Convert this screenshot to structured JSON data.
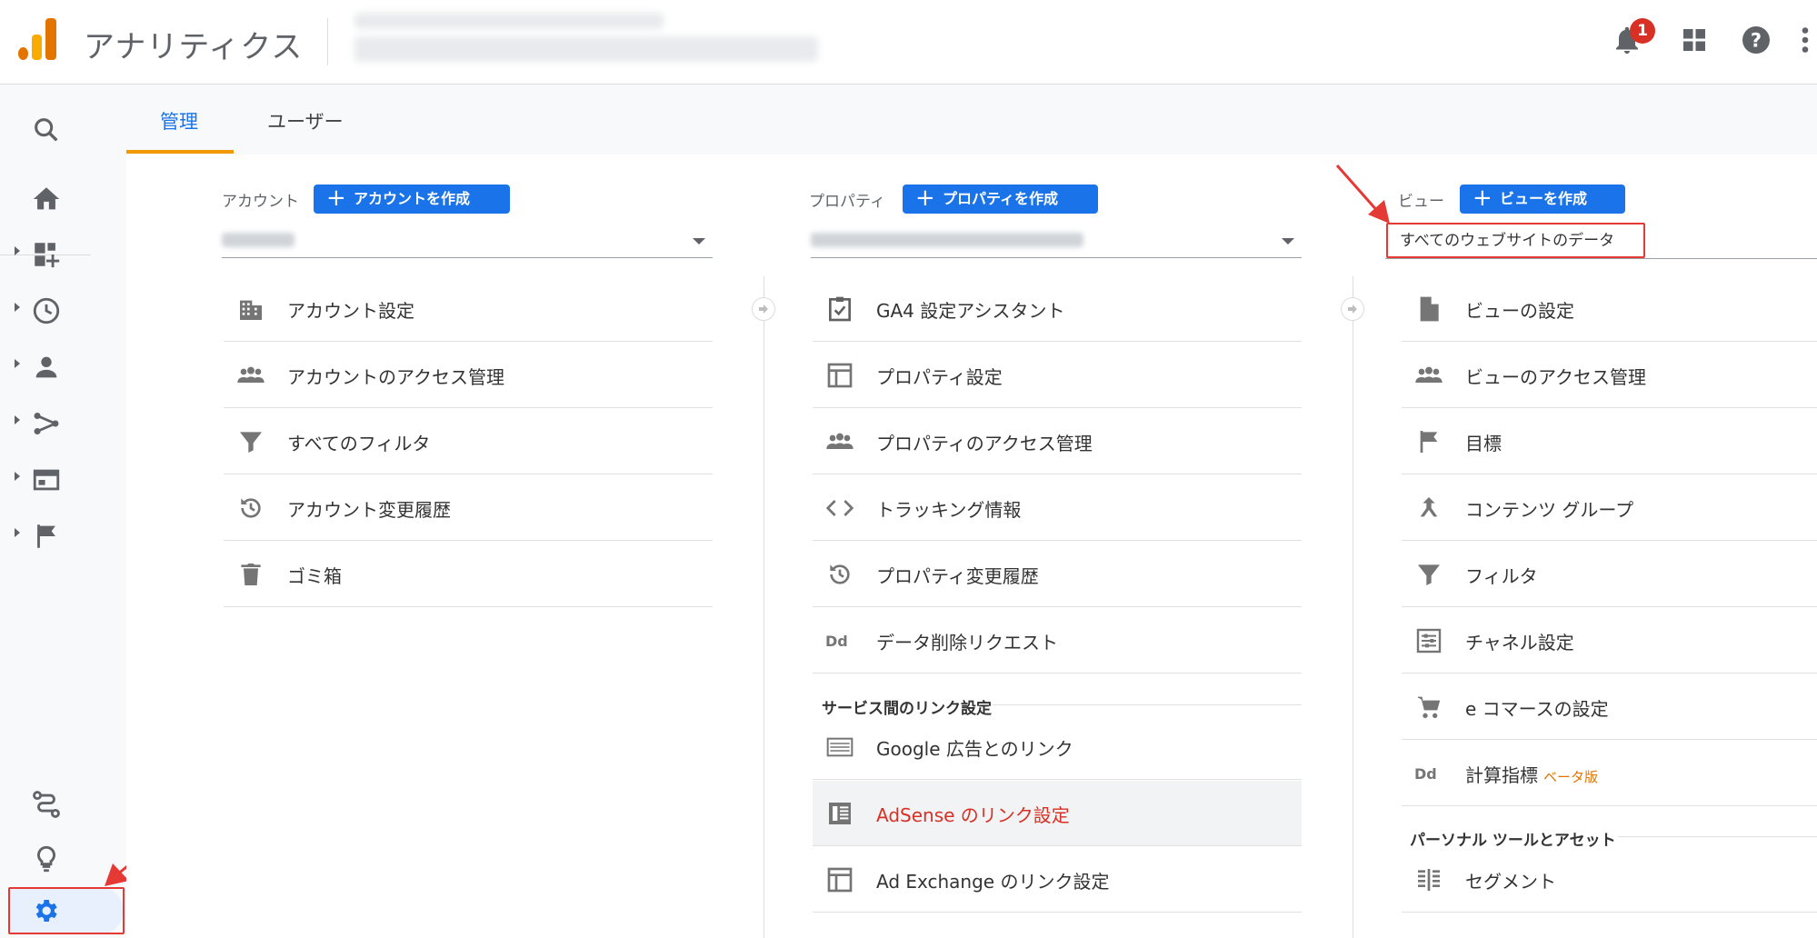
{
  "header": {
    "app_title": "アナリティクス",
    "notification_count": "1"
  },
  "tabs": [
    {
      "label": "管理",
      "active": true
    },
    {
      "label": "ユーザー",
      "active": false
    }
  ],
  "account_col": {
    "label": "アカウント",
    "create_label": "アカウントを作成",
    "items": [
      {
        "label": "アカウント設定",
        "icon": "building-icon"
      },
      {
        "label": "アカウントのアクセス管理",
        "icon": "people-icon"
      },
      {
        "label": "すべてのフィルタ",
        "icon": "filter-icon"
      },
      {
        "label": "アカウント変更履歴",
        "icon": "history-icon"
      },
      {
        "label": "ゴミ箱",
        "icon": "trash-icon"
      }
    ]
  },
  "property_col": {
    "label": "プロパティ",
    "create_label": "プロパティを作成",
    "items": [
      {
        "label": "GA4 設定アシスタント",
        "icon": "clipboard-check-icon"
      },
      {
        "label": "プロパティ設定",
        "icon": "layout-icon"
      },
      {
        "label": "プロパティのアクセス管理",
        "icon": "people-icon"
      },
      {
        "label": "トラッキング情報",
        "icon": "code-icon"
      },
      {
        "label": "プロパティ変更履歴",
        "icon": "history-icon"
      },
      {
        "label": "データ削除リクエスト",
        "icon": "dd-icon"
      }
    ],
    "section_title": "サービス間のリンク設定",
    "link_items": [
      {
        "label": "Google 広告とのリンク",
        "icon": "ads-icon"
      },
      {
        "label": "AdSense のリンク設定",
        "icon": "adsense-icon"
      },
      {
        "label": "Ad Exchange のリンク設定",
        "icon": "layout-icon"
      }
    ]
  },
  "view_col": {
    "label": "ビュー",
    "create_label": "ビューを作成",
    "selected_view": "すべてのウェブサイトのデータ",
    "items": [
      {
        "label": "ビューの設定",
        "icon": "document-icon"
      },
      {
        "label": "ビューのアクセス管理",
        "icon": "people-icon"
      },
      {
        "label": "目標",
        "icon": "flag-icon"
      },
      {
        "label": "コンテンツ グループ",
        "icon": "content-group-icon"
      },
      {
        "label": "フィルタ",
        "icon": "filter-icon"
      },
      {
        "label": "チャネル設定",
        "icon": "channel-icon"
      },
      {
        "label": "e コマースの設定",
        "icon": "cart-icon"
      },
      {
        "label": "計算指標",
        "icon": "dd-icon",
        "badge": "ベータ版"
      }
    ],
    "section_title": "パーソナル ツールとアセット",
    "tool_items": [
      {
        "label": "セグメント",
        "icon": "segment-icon"
      }
    ]
  },
  "colors": {
    "brand_orange": "#f9ab00",
    "brand_dark_orange": "#e37400",
    "primary_blue": "#1a73e8",
    "annotation_red": "#e53935"
  }
}
